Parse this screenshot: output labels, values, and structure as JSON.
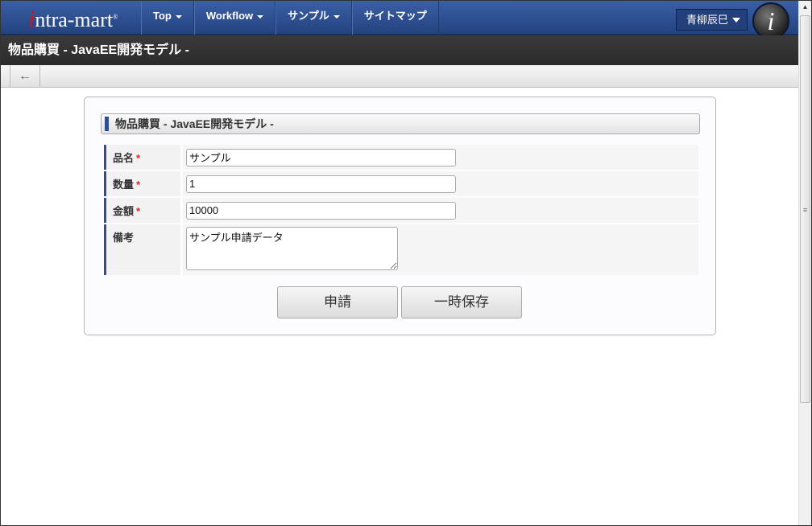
{
  "header": {
    "logo": "intra-mart",
    "nav": [
      {
        "label": "Top",
        "dropdown": true
      },
      {
        "label": "Workflow",
        "dropdown": true
      },
      {
        "label": "サンプル",
        "dropdown": true
      },
      {
        "label": "サイトマップ",
        "dropdown": false
      }
    ],
    "user": "青柳辰巳",
    "info_logo": "i"
  },
  "page_title": "物品購買 - JavaEE開発モデル -",
  "toolbar": {
    "back_icon": "←"
  },
  "form": {
    "title": "物品購買 - JavaEE開発モデル -",
    "fields": [
      {
        "label": "品名",
        "required": "*",
        "value": "サンプル"
      },
      {
        "label": "数量",
        "required": "*",
        "value": "1"
      },
      {
        "label": "金額",
        "required": "*",
        "value": "10000"
      },
      {
        "label": "備考",
        "value": "サンプル申請データ"
      }
    ],
    "submit": "申請",
    "save": "一時保存"
  }
}
